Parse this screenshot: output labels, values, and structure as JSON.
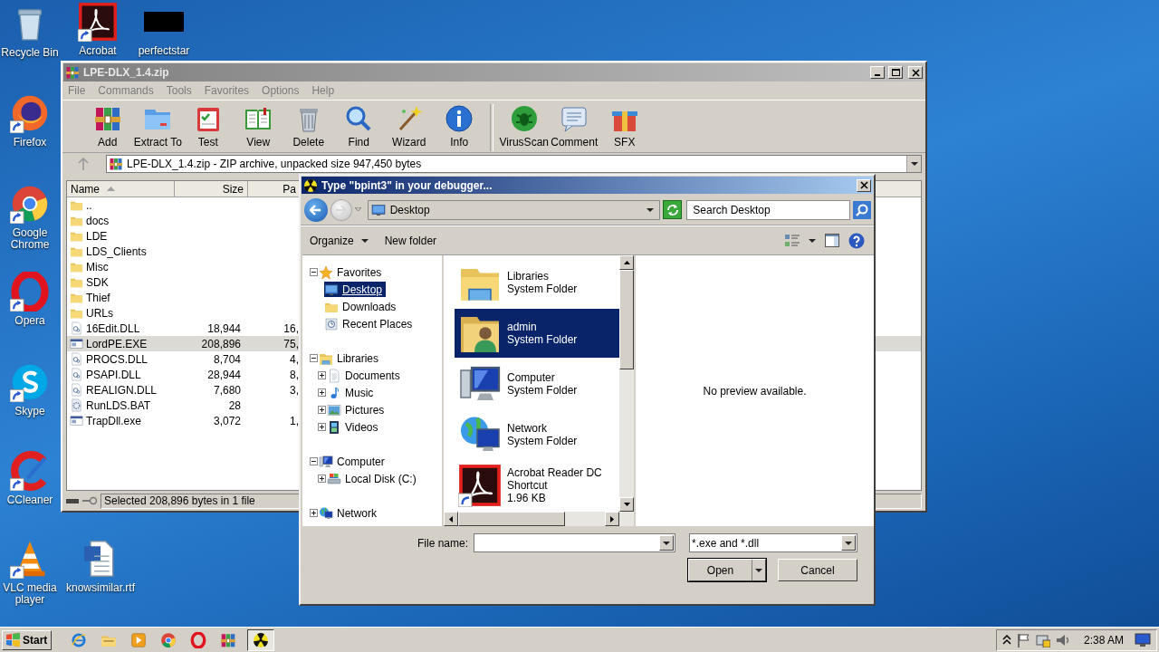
{
  "desktop_icons": [
    {
      "label": "Recycle Bin",
      "kind": "recycle",
      "shortcut": false
    },
    {
      "label": "Acrobat",
      "kind": "acrobat",
      "shortcut": true
    },
    {
      "label": "perfectstar",
      "kind": "blank",
      "shortcut": false
    },
    {
      "label": "Firefox",
      "kind": "firefox",
      "shortcut": true
    },
    {
      "label": "Google Chrome",
      "kind": "chrome",
      "shortcut": true
    },
    {
      "label": "Opera",
      "kind": "opera",
      "shortcut": true
    },
    {
      "label": "Skype",
      "kind": "skype",
      "shortcut": true
    },
    {
      "label": "CCleaner",
      "kind": "ccleaner",
      "shortcut": true
    },
    {
      "label": "VLC media player",
      "kind": "vlc",
      "shortcut": true
    },
    {
      "label": "knowsimilar.rtf",
      "kind": "word",
      "shortcut": false
    }
  ],
  "archiver": {
    "title": "LPE-DLX_1.4.zip",
    "menu": [
      "File",
      "Commands",
      "Tools",
      "Favorites",
      "Options",
      "Help"
    ],
    "toolbar_groups": [
      [
        {
          "label": "Add",
          "kind": "add"
        },
        {
          "label": "Extract To",
          "kind": "extract"
        },
        {
          "label": "Test",
          "kind": "test"
        },
        {
          "label": "View",
          "kind": "view"
        },
        {
          "label": "Delete",
          "kind": "delete"
        },
        {
          "label": "Find",
          "kind": "find"
        },
        {
          "label": "Wizard",
          "kind": "wizard"
        },
        {
          "label": "Info",
          "kind": "info"
        }
      ],
      [
        {
          "label": "VirusScan",
          "kind": "virus"
        },
        {
          "label": "Comment",
          "kind": "comment"
        },
        {
          "label": "SFX",
          "kind": "sfx"
        }
      ]
    ],
    "path": "LPE-DLX_1.4.zip - ZIP archive, unpacked size 947,450 bytes",
    "columns": [
      "Name",
      "Size",
      "Pa"
    ],
    "rows": [
      {
        "name": "..",
        "kind": "folder",
        "selected": false
      },
      {
        "name": "docs",
        "kind": "folder",
        "selected": false
      },
      {
        "name": "LDE",
        "kind": "folder",
        "selected": false
      },
      {
        "name": "LDS_Clients",
        "kind": "folder",
        "selected": false
      },
      {
        "name": "Misc",
        "kind": "folder",
        "selected": false
      },
      {
        "name": "SDK",
        "kind": "folder",
        "selected": false
      },
      {
        "name": "Thief",
        "kind": "folder",
        "selected": false
      },
      {
        "name": "URLs",
        "kind": "folder",
        "selected": false
      },
      {
        "name": "16Edit.DLL",
        "kind": "dll",
        "size": "18,944",
        "packed": "16,",
        "selected": false
      },
      {
        "name": "LordPE.EXE",
        "kind": "exe",
        "size": "208,896",
        "packed": "75,",
        "selected": true
      },
      {
        "name": "PROCS.DLL",
        "kind": "dll",
        "size": "8,704",
        "packed": "4,",
        "selected": false
      },
      {
        "name": "PSAPI.DLL",
        "kind": "dll",
        "size": "28,944",
        "packed": "8,",
        "selected": false
      },
      {
        "name": "REALIGN.DLL",
        "kind": "dll",
        "size": "7,680",
        "packed": "3,",
        "selected": false
      },
      {
        "name": "RunLDS.BAT",
        "kind": "bat",
        "size": "28",
        "selected": false
      },
      {
        "name": "TrapDll.exe",
        "kind": "exe",
        "size": "3,072",
        "packed": "1,",
        "selected": false
      }
    ],
    "status": "Selected 208,896 bytes in 1 file"
  },
  "dialog": {
    "title": "Type \"bpint3\" in your debugger...",
    "location": "Desktop",
    "search_placeholder": "Search Desktop",
    "commands": [
      {
        "label": "Organize",
        "dropdown": true
      },
      {
        "label": "New folder",
        "dropdown": false
      }
    ],
    "tree": [
      {
        "label": "Favorites",
        "kind": "star",
        "expanded": true,
        "selected": false,
        "children": [
          {
            "label": "Desktop",
            "kind": "desktop",
            "selected": true
          },
          {
            "label": "Downloads",
            "kind": "downloads",
            "selected": false
          },
          {
            "label": "Recent Places",
            "kind": "recent",
            "selected": false
          }
        ]
      },
      {
        "label": "Libraries",
        "kind": "libraries",
        "expanded": true,
        "selected": false,
        "children": [
          {
            "label": "Documents",
            "kind": "documents",
            "expanded": false,
            "selected": false
          },
          {
            "label": "Music",
            "kind": "music",
            "expanded": false,
            "selected": false
          },
          {
            "label": "Pictures",
            "kind": "pictures",
            "expanded": false,
            "selected": false
          },
          {
            "label": "Videos",
            "kind": "videos",
            "expanded": false,
            "selected": false
          }
        ]
      },
      {
        "label": "Computer",
        "kind": "computer",
        "expanded": true,
        "selected": false,
        "children": [
          {
            "label": "Local Disk (C:)",
            "kind": "disk",
            "expanded": false,
            "selected": false
          }
        ]
      },
      {
        "label": "Network",
        "kind": "network",
        "expanded": false,
        "selected": false
      }
    ],
    "items": [
      {
        "name": "Libraries",
        "details": [
          "System Folder"
        ],
        "kind": "libraries",
        "selected": false
      },
      {
        "name": "admin",
        "details": [
          "System Folder"
        ],
        "kind": "user",
        "selected": true
      },
      {
        "name": "Computer",
        "details": [
          "System Folder"
        ],
        "kind": "computer",
        "selected": false
      },
      {
        "name": "Network",
        "details": [
          "System Folder"
        ],
        "kind": "network",
        "selected": false
      },
      {
        "name": "Acrobat Reader DC",
        "details": [
          "Shortcut",
          "1.96 KB"
        ],
        "kind": "acrobat",
        "selected": false
      }
    ],
    "preview": "No preview available.",
    "file_name_label": "File name:",
    "file_type": "*.exe and *.dll",
    "buttons": [
      {
        "label": "Open",
        "kind": "split"
      },
      {
        "label": "Cancel",
        "kind": "plain"
      }
    ]
  },
  "taskbar": {
    "start": "Start",
    "apps": [
      {
        "kind": "ie",
        "active": false
      },
      {
        "kind": "explorer",
        "active": false
      },
      {
        "kind": "media",
        "active": false
      },
      {
        "kind": "chrome",
        "active": false
      },
      {
        "kind": "opera",
        "active": false
      },
      {
        "kind": "winrar",
        "active": false
      },
      {
        "kind": "debugger",
        "active": true
      }
    ],
    "clock": "2:38 AM"
  }
}
